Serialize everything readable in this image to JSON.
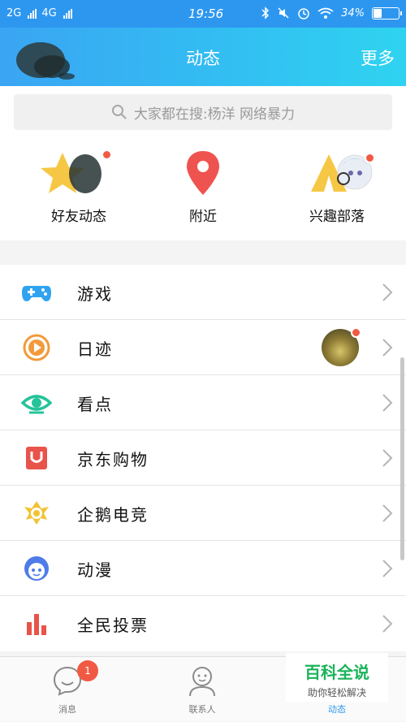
{
  "status": {
    "net1": "2G",
    "net2": "4G",
    "time": "19:56",
    "battery": "34%",
    "battery_level": 0.34
  },
  "header": {
    "title": "动态",
    "more": "更多"
  },
  "search": {
    "placeholder": "大家都在搜:杨洋 网络暴力"
  },
  "quick": [
    {
      "label": "好友动态",
      "icon": "friend-star-icon"
    },
    {
      "label": "附近",
      "icon": "location-pin-icon"
    },
    {
      "label": "兴趣部落",
      "icon": "tribe-tent-icon"
    }
  ],
  "list": [
    {
      "label": "游戏",
      "icon": "gamepad-icon",
      "color": "#2fa3f0"
    },
    {
      "label": "日迹",
      "icon": "play-circle-icon",
      "color": "#f29a3a"
    },
    {
      "label": "看点",
      "icon": "eye-icon",
      "color": "#25c39a"
    },
    {
      "label": "京东购物",
      "icon": "jd-bag-icon",
      "color": "#e8534a"
    },
    {
      "label": "企鹅电竞",
      "icon": "penguin-esports-icon",
      "color": "#f1c232"
    },
    {
      "label": "动漫",
      "icon": "anime-face-icon",
      "color": "#4f7be8"
    },
    {
      "label": "全民投票",
      "icon": "bar-chart-icon",
      "color": "#e8534a"
    }
  ],
  "tabs": [
    {
      "label": "消息",
      "badge": "1"
    },
    {
      "label": "联系人"
    },
    {
      "label": "动态"
    }
  ],
  "watermark": {
    "line1": "百科全说",
    "line2": "助你轻松解决"
  }
}
